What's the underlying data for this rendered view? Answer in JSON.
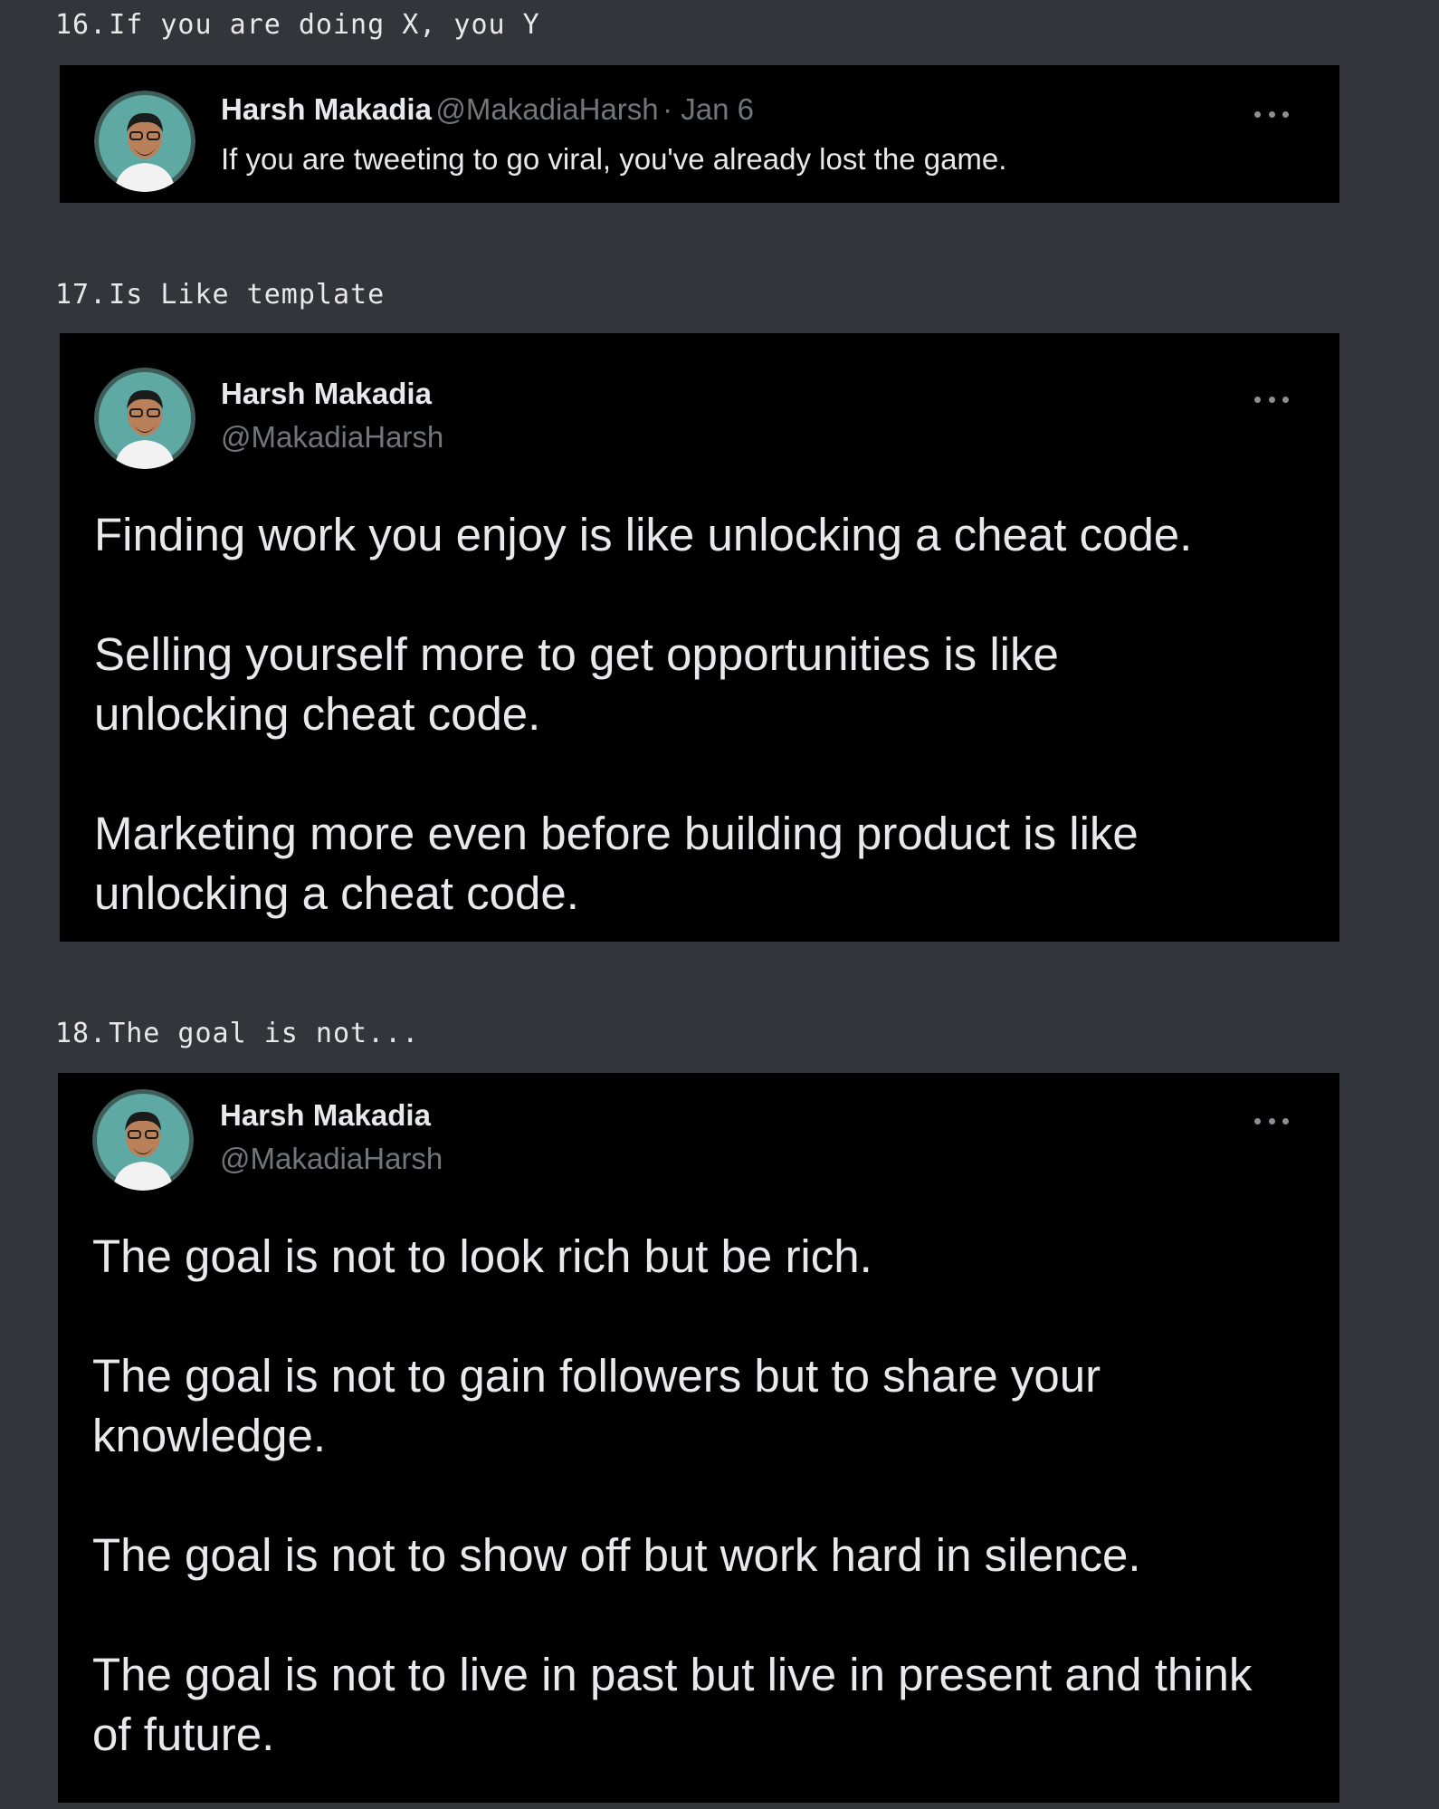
{
  "sections": [
    {
      "number": "16.",
      "title": "If you are doing X, you Y",
      "tweet": {
        "name": "Harsh Makadia",
        "handle": "@MakadiaHarsh",
        "date": "· Jan 6",
        "paragraphs": [
          "If you are tweeting to go viral, you've already lost the game."
        ]
      }
    },
    {
      "number": "17.",
      "title": "Is Like template",
      "tweet": {
        "name": "Harsh Makadia",
        "handle": "@MakadiaHarsh",
        "paragraphs": [
          "Finding work you enjoy is like unlocking a cheat code.",
          "Selling yourself more to get opportunities is like unlocking cheat code.",
          "Marketing more even before building product is like unlocking a cheat code."
        ]
      }
    },
    {
      "number": "18.",
      "title": "The goal is not...",
      "tweet": {
        "name": "Harsh Makadia",
        "handle": "@MakadiaHarsh",
        "paragraphs": [
          "The goal is not to look rich but be rich.",
          "The goal is not to gain followers but to share your knowledge.",
          "The goal is not to show off but work hard in silence.",
          "The goal is not to live in past but live in present and think of future."
        ]
      }
    }
  ],
  "icons": {
    "avatar": "avatar-icon",
    "more": "more-options-icon"
  },
  "colors": {
    "page_background": "#323539",
    "card_background": "#000000",
    "name_text": "#e7e9ea",
    "handle_text": "#71767b",
    "avatar_background": "#5fa9a4"
  }
}
